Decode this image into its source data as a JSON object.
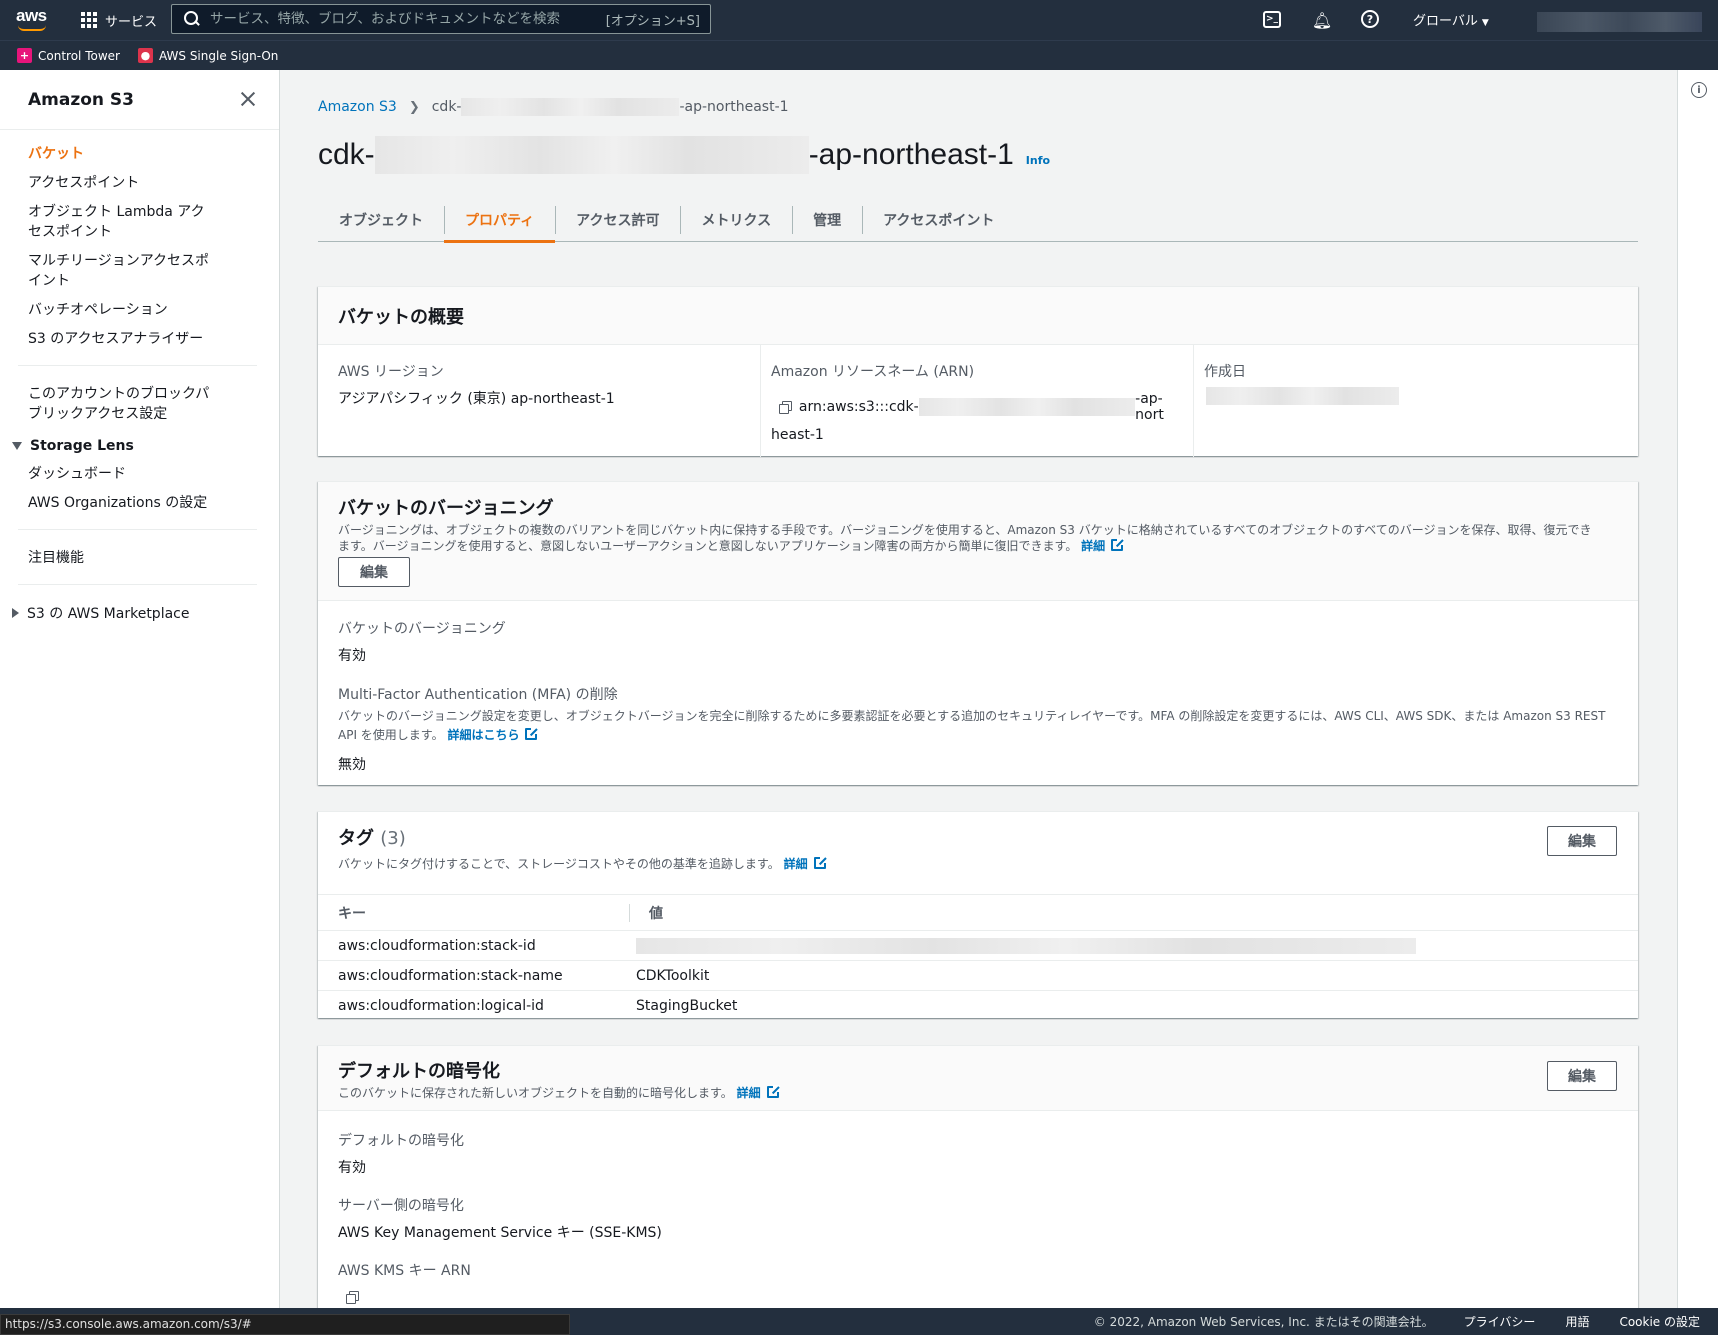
{
  "topnav": {
    "logo_text": "aws",
    "services_label": "サービス",
    "search_placeholder": "サービス、特徴、ブログ、およびドキュメントなどを検索",
    "search_shortcut": "[オプション+S]",
    "region_label": "グローバル"
  },
  "favorites": [
    {
      "label": "Control Tower"
    },
    {
      "label": "AWS Single Sign-On"
    }
  ],
  "sidenav": {
    "title": "Amazon S3",
    "items": [
      {
        "label": "バケット"
      },
      {
        "label": "アクセスポイント"
      },
      {
        "label": "オブジェクト Lambda アクセスポイント"
      },
      {
        "label": "マルチリージョンアクセスポイント"
      },
      {
        "label": "バッチオペレーション"
      },
      {
        "label": "S3 のアクセスアナライザー"
      }
    ],
    "block_public_access": "このアカウントのブロックパブリックアクセス設定",
    "storage_lens": {
      "label": "Storage Lens",
      "items": [
        {
          "label": "ダッシュボード"
        },
        {
          "label": "AWS Organizations の設定"
        }
      ]
    },
    "featured": "注目機能",
    "marketplace": "S3 の AWS Marketplace"
  },
  "breadcrumb": {
    "root": "Amazon S3",
    "current_prefix": "cdk-",
    "current_suffix": "-ap-northeast-1"
  },
  "page": {
    "title_prefix": "cdk-",
    "title_suffix": "-ap-northeast-1",
    "info": "Info"
  },
  "tabs": [
    {
      "label": "オブジェクト"
    },
    {
      "label": "プロパティ"
    },
    {
      "label": "アクセス許可"
    },
    {
      "label": "メトリクス"
    },
    {
      "label": "管理"
    },
    {
      "label": "アクセスポイント"
    }
  ],
  "overview": {
    "title": "バケットの概要",
    "region_label": "AWS リージョン",
    "region_value": "アジアパシフィック (東京) ap-northeast-1",
    "arn_label": "Amazon リソースネーム (ARN)",
    "arn_prefix": "arn:aws:s3:::cdk-",
    "arn_suffix": "-ap-nort",
    "arn_tail": "heast-1",
    "created_label": "作成日"
  },
  "versioning": {
    "title": "バケットのバージョニング",
    "desc": "バージョニングは、オブジェクトの複数のバリアントを同じバケット内に保持する手段です。バージョニングを使用すると、Amazon S3 バケットに格納されているすべてのオブジェクトのすべてのバージョンを保存、取得、復元できます。バージョニングを使用すると、意図しないユーザーアクションと意図しないアプリケーション障害の両方から簡単に復旧できます。",
    "learn_more": "詳細",
    "edit": "編集",
    "status_label": "バケットのバージョニング",
    "status_value": "有効",
    "mfa_label": "Multi-Factor Authentication (MFA) の削除",
    "mfa_desc": "バケットのバージョニング設定を変更し、オブジェクトバージョンを完全に削除するために多要素認証を必要とする追加のセキュリティレイヤーです。MFA の削除設定を変更するには、AWS CLI、AWS SDK、または Amazon S3 REST API を使用します。",
    "mfa_learn_more": "詳細はこちら",
    "mfa_value": "無効"
  },
  "tags": {
    "title": "タグ",
    "count": "(3)",
    "desc": "バケットにタグ付けすることで、ストレージコストやその他の基準を追跡します。",
    "learn_more": "詳細",
    "edit": "編集",
    "col_key": "キー",
    "col_value": "値",
    "rows": [
      {
        "key": "aws:cloudformation:stack-id",
        "value": ""
      },
      {
        "key": "aws:cloudformation:stack-name",
        "value": "CDKToolkit"
      },
      {
        "key": "aws:cloudformation:logical-id",
        "value": "StagingBucket"
      }
    ]
  },
  "encryption": {
    "title": "デフォルトの暗号化",
    "desc": "このバケットに保存された新しいオブジェクトを自動的に暗号化します。",
    "learn_more": "詳細",
    "edit": "編集",
    "default_label": "デフォルトの暗号化",
    "default_value": "有効",
    "sse_label": "サーバー側の暗号化",
    "sse_value": "AWS Key Management Service キー (SSE-KMS)",
    "kms_label": "AWS KMS キー ARN"
  },
  "footer": {
    "copyright": "© 2022, Amazon Web Services, Inc. またはその関連会社。",
    "privacy": "プライバシー",
    "terms": "用語",
    "cookie": "Cookie の設定"
  },
  "status_url": "https://s3.console.aws.amazon.com/s3/#"
}
